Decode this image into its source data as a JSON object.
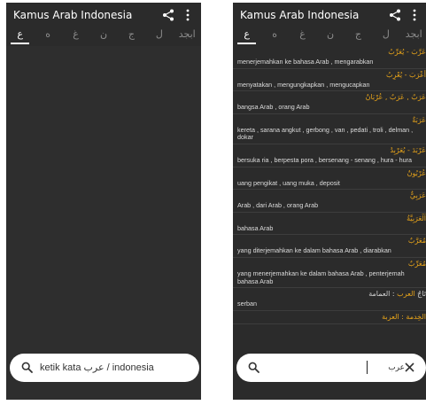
{
  "left_screen": {
    "app_title": "Kamus Arab Indonesia",
    "tabs": [
      "ع",
      "ه",
      "غ",
      "ن",
      "ج",
      "ل",
      "‎ابجد"
    ],
    "search": {
      "placeholder": "ketik kata عرب / indonesia"
    }
  },
  "right_screen": {
    "app_title": "Kamus Arab Indonesia",
    "tabs": [
      "ع",
      "ه",
      "غ",
      "ن",
      "ج",
      "ل",
      "‎ابجد"
    ],
    "entries": [
      {
        "head": "عَرَّبَ - يُعَرِّبُ",
        "body": "menerjemahkan ke bahasa Arab , mengarabkan"
      },
      {
        "head": "أَعْرَبَ - يُعْرِبُ",
        "body": "menyatakan , mengungkapkan , mengucapkan"
      },
      {
        "head": "عَرَبٌ , عَرَبٌ , عُرْبَانٌ",
        "body": "bangsa Arab , orang Arab"
      },
      {
        "head": "عَرَبَةٌ",
        "body": "kereta , sarana angkut , gerbong , van , pedati , troli , delman , dokar"
      },
      {
        "head": "عَرْبَدَ - يُعَرْبِدُ",
        "body": "bersuka ria , berpesta pora , bersenang - senang , hura - hura"
      },
      {
        "head": "عُرْبُونٌ",
        "body": "uang pengikat , uang muka , deposit"
      },
      {
        "head": "عَرَبِيٌّ",
        "body": "Arab , dari Arab , orang Arab"
      },
      {
        "head": "اَلْعَرَبِيَّةُ",
        "body": "bahasa Arab"
      },
      {
        "head": "مُعَرَّبٌ",
        "body": "yang diterjemahkan ke dalam bahasa Arab , diarabkan"
      },
      {
        "head": "مُعَرِّبٌ",
        "body": "yang menerjemahkan ke dalam bahasa Arab , penterjemah bahasa Arab"
      },
      {
        "head_prefix": "تَاجُ",
        "head": "العرب",
        "head_suffix": ": العمامة",
        "body": "serban"
      },
      {
        "head": "الخِدمة : العزبة",
        "body": ""
      }
    ],
    "search": {
      "value": "عرب"
    }
  },
  "colors": {
    "background": "#2b2b2b",
    "arabic_headword": "#e6a31a",
    "text": "#dcdcdc",
    "searchbar": "#ffffff"
  },
  "icons": [
    "share-icon",
    "more-vert-icon",
    "search-icon",
    "close-icon"
  ]
}
